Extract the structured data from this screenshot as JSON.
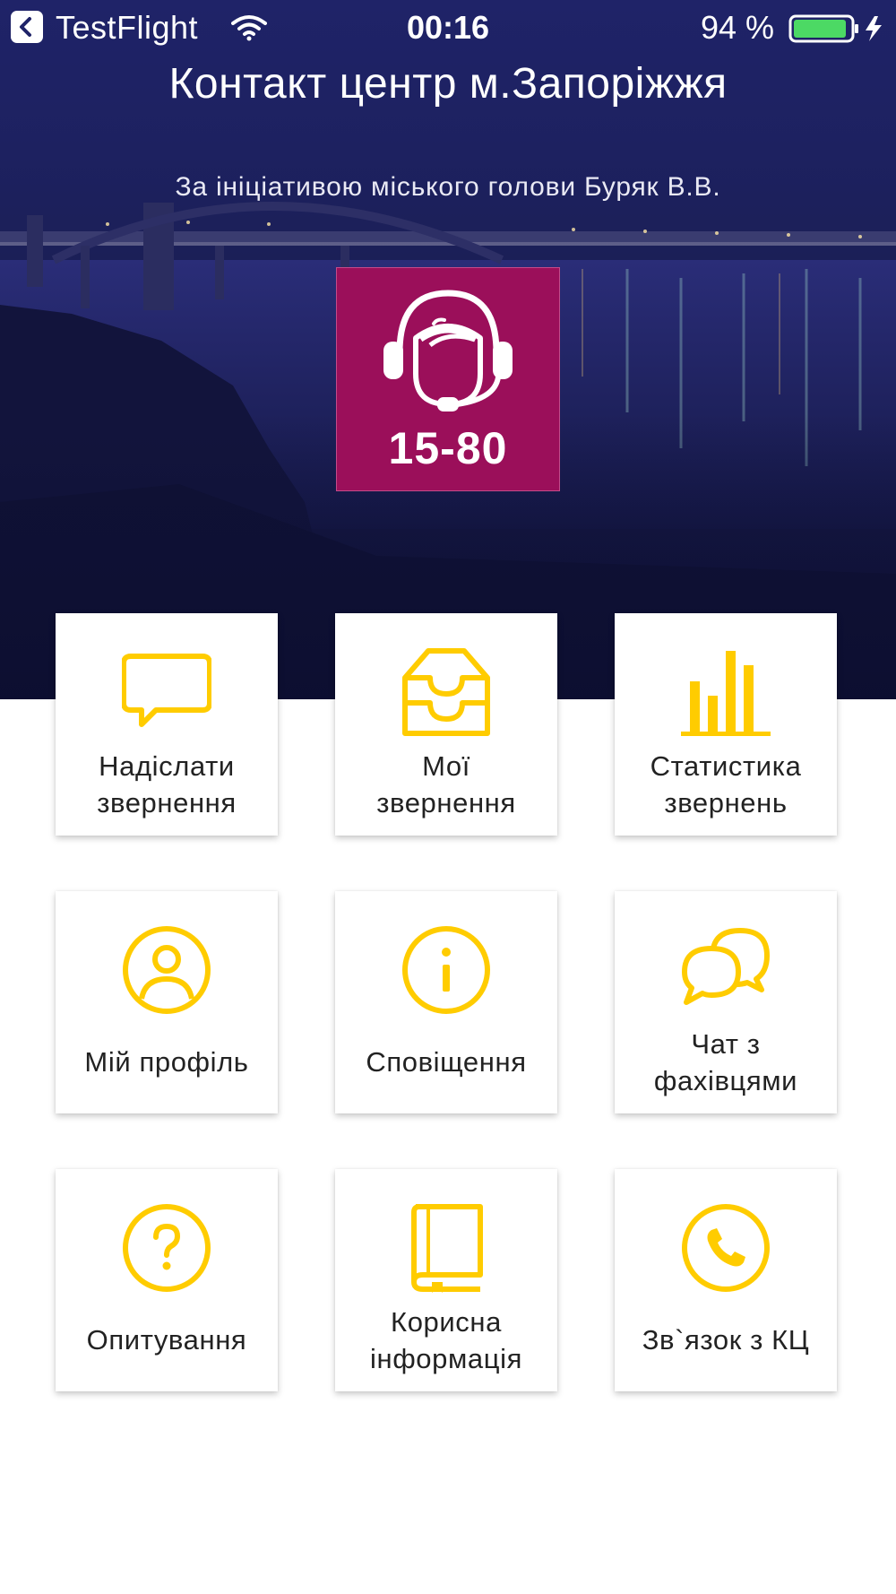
{
  "status_bar": {
    "back_app": "TestFlight",
    "time": "00:16",
    "battery_percent": "94 %",
    "battery_level": 0.94,
    "battery_color": "#4cd964"
  },
  "header": {
    "title": "Контакт центр м.Запоріжжя",
    "subtitle": "За ініціативою міського голови Буряк В.В."
  },
  "logo": {
    "number": "15-80",
    "icon": "headset-operator-icon",
    "background": "#9b0f5a"
  },
  "accent_color": "#ffcc00",
  "tiles": [
    {
      "icon": "chat-bubble-icon",
      "line1": "Надіслати",
      "line2": "звернення"
    },
    {
      "icon": "inbox-tray-icon",
      "line1": "Мої",
      "line2": "звернення"
    },
    {
      "icon": "bar-chart-icon",
      "line1": "Статистика",
      "line2": "звернень"
    },
    {
      "icon": "user-profile-icon",
      "line1": "Мій профіль",
      "line2": ""
    },
    {
      "icon": "info-icon",
      "line1": "Сповіщення",
      "line2": ""
    },
    {
      "icon": "chat-bubbles-icon",
      "line1": "Чат з",
      "line2": "фахівцями"
    },
    {
      "icon": "question-icon",
      "line1": "Опитування",
      "line2": ""
    },
    {
      "icon": "book-icon",
      "line1": "Корисна",
      "line2": "інформація"
    },
    {
      "icon": "phone-icon",
      "line1": "Зв`язок з КЦ",
      "line2": ""
    }
  ]
}
